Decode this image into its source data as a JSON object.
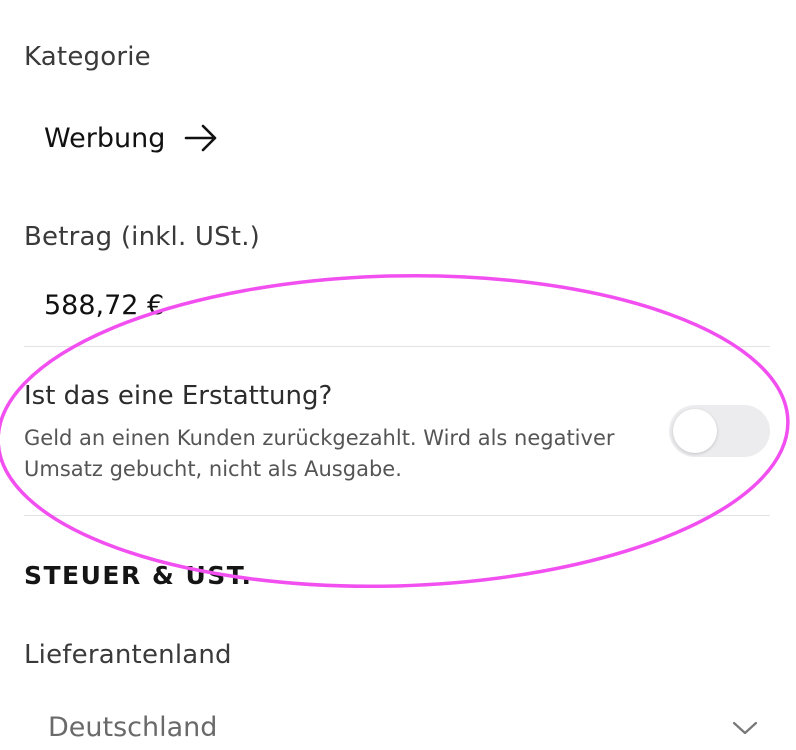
{
  "category": {
    "label": "Kategorie",
    "value": "Werbung",
    "icon": "arrow-right-icon"
  },
  "amount": {
    "label": "Betrag (inkl. USt.)",
    "value": "588,72 €"
  },
  "refund": {
    "title": "Ist das eine Erstattung?",
    "description": "Geld an einen Kunden zurückgezahlt. Wird als negativer Umsatz gebucht, nicht als Ausgabe.",
    "toggle_on": false
  },
  "tax_section": {
    "heading": "STEUER & UST."
  },
  "supplier_country": {
    "label": "Lieferantenland",
    "value": "Deutschland",
    "icon": "chevron-down-icon"
  },
  "colors": {
    "annotation": "#f24ff0",
    "toggle_track_off": "#ececee",
    "divider": "#e3e3e3"
  }
}
